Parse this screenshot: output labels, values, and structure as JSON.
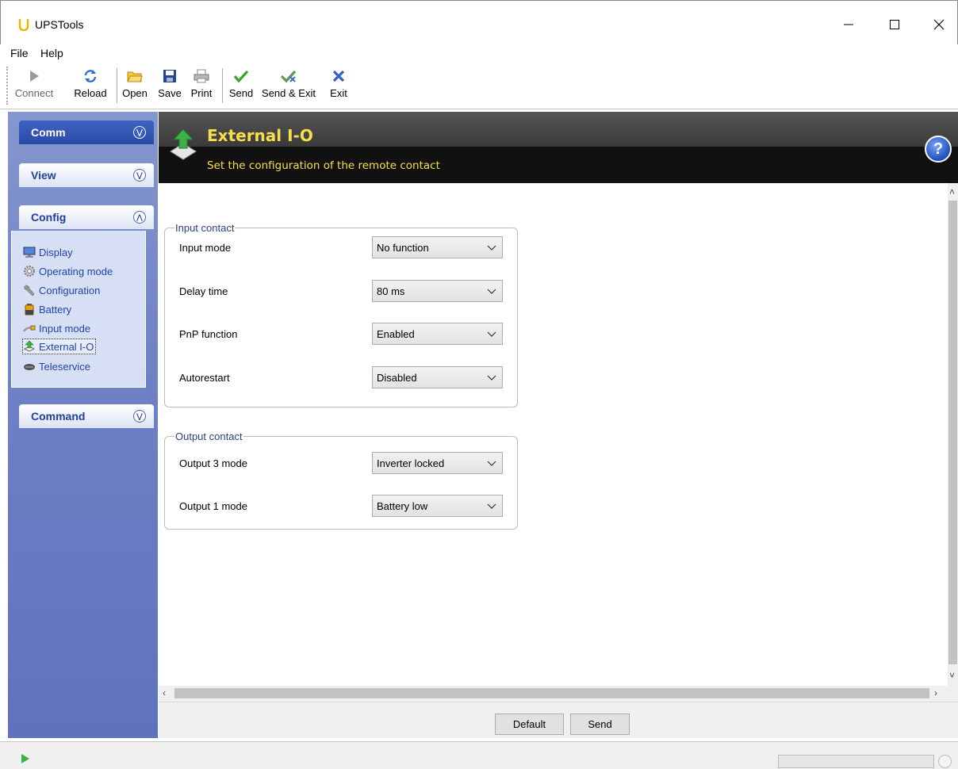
{
  "window": {
    "title": "UPSTools"
  },
  "menu": {
    "items": [
      "File",
      "Help"
    ]
  },
  "toolbar": {
    "connect": "Connect",
    "reload": "Reload",
    "open": "Open",
    "save": "Save",
    "print": "Print",
    "send": "Send",
    "send_exit": "Send & Exit",
    "exit": "Exit"
  },
  "sidebar": {
    "panels": {
      "comm": "Comm",
      "view": "View",
      "config": "Config",
      "command": "Command"
    },
    "config_items": [
      {
        "label": "Display",
        "icon": "monitor-icon"
      },
      {
        "label": "Operating mode",
        "icon": "gear-icon"
      },
      {
        "label": "Configuration",
        "icon": "wrench-icon"
      },
      {
        "label": "Battery",
        "icon": "battery-icon"
      },
      {
        "label": "Input mode",
        "icon": "plug-icon"
      },
      {
        "label": "External I-O",
        "icon": "upload-arrow-icon"
      },
      {
        "label": "Teleservice",
        "icon": "modem-icon"
      }
    ],
    "selected": "External I-O"
  },
  "header": {
    "title": "External I-O",
    "subtitle": "Set the configuration of the remote contact"
  },
  "input_contact": {
    "legend": "Input contact",
    "rows": [
      {
        "label": "Input mode",
        "value": "No function"
      },
      {
        "label": "Delay time",
        "value": "80 ms"
      },
      {
        "label": "PnP function",
        "value": "Enabled"
      },
      {
        "label": "Autorestart",
        "value": "Disabled"
      }
    ]
  },
  "output_contact": {
    "legend": "Output contact",
    "rows": [
      {
        "label": "Output 3 mode",
        "value": "Inverter locked"
      },
      {
        "label": "Output 1 mode",
        "value": "Battery low"
      }
    ]
  },
  "buttons": {
    "default": "Default",
    "send": "Send"
  },
  "colors": {
    "title_yellow": "#f5e04a",
    "sidebar_blue": "#6f82c6",
    "active_panel": "#2a4aa8",
    "link_blue": "#2244aa"
  }
}
